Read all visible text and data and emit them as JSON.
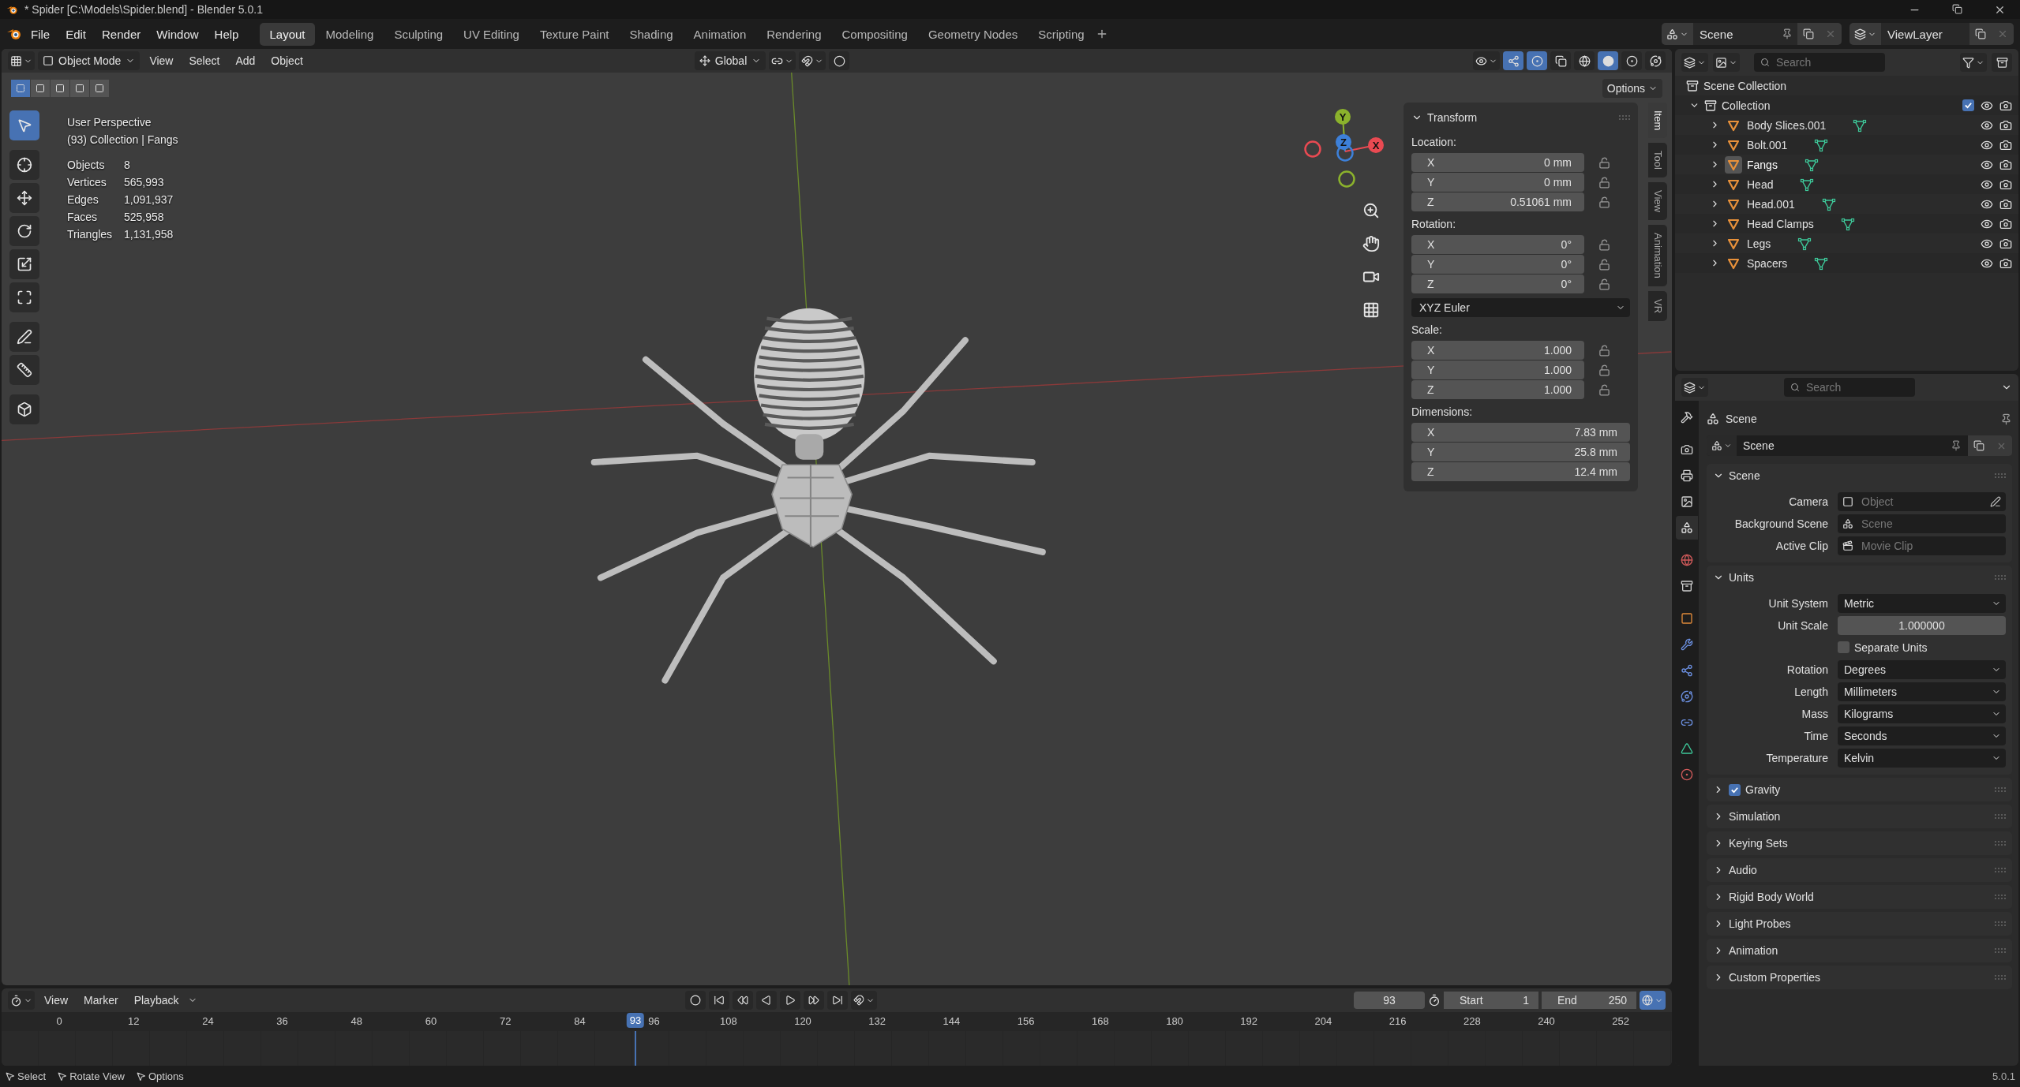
{
  "title_bar": {
    "title": "* Spider [C:\\Models\\Spider.blend] - Blender 5.0.1"
  },
  "top_bar": {
    "menus": [
      "File",
      "Edit",
      "Render",
      "Window",
      "Help"
    ],
    "workspaces": [
      {
        "label": "Layout",
        "selected": true
      },
      {
        "label": "Modeling",
        "selected": false
      },
      {
        "label": "Sculpting",
        "selected": false
      },
      {
        "label": "UV Editing",
        "selected": false
      },
      {
        "label": "Texture Paint",
        "selected": false
      },
      {
        "label": "Shading",
        "selected": false
      },
      {
        "label": "Animation",
        "selected": false
      },
      {
        "label": "Rendering",
        "selected": false
      },
      {
        "label": "Compositing",
        "selected": false
      },
      {
        "label": "Geometry Nodes",
        "selected": false
      },
      {
        "label": "Scripting",
        "selected": false
      }
    ],
    "scene": "Scene",
    "view_layer": "ViewLayer"
  },
  "viewport": {
    "mode": "Object Mode",
    "menus": [
      "View",
      "Select",
      "Add",
      "Object"
    ],
    "orientation": "Global",
    "options": "Options",
    "tools": [
      {
        "kind": "select",
        "selected": true
      },
      {
        "kind": "cursor",
        "selected": false
      },
      {
        "kind": "move",
        "selected": false
      },
      {
        "kind": "rotate",
        "selected": false
      },
      {
        "kind": "scale",
        "selected": false
      },
      {
        "kind": "transform",
        "selected": false
      },
      {
        "kind": "annotate",
        "selected": false
      },
      {
        "kind": "measure",
        "selected": false
      },
      {
        "kind": "add_cube",
        "selected": false
      }
    ],
    "info": {
      "perspective": "User Perspective",
      "context": "(93) Collection | Fangs",
      "stats": [
        {
          "label": "Objects",
          "value": "8"
        },
        {
          "label": "Vertices",
          "value": "565,993"
        },
        {
          "label": "Edges",
          "value": "1,091,937"
        },
        {
          "label": "Faces",
          "value": "525,958"
        },
        {
          "label": "Triangles",
          "value": "1,131,958"
        }
      ]
    },
    "gizmo": [
      {
        "label": "Y",
        "color": "#8bb22c"
      },
      {
        "label": "Z",
        "color": "#3d80d9"
      },
      {
        "label": "X",
        "color": "#e94a52"
      }
    ],
    "sidebar_tabs": [
      {
        "label": "Item",
        "selected": true
      },
      {
        "label": "Tool",
        "selected": false
      },
      {
        "label": "View",
        "selected": false
      },
      {
        "label": "Animation",
        "selected": false
      },
      {
        "label": "VR",
        "selected": false
      }
    ],
    "transform": {
      "title": "Transform",
      "expanded": true,
      "sections": [
        {
          "kind": "vector",
          "label": "Location:",
          "fields": [
            {
              "axis": "X",
              "value": "0 mm",
              "locked": false
            },
            {
              "axis": "Y",
              "value": "0 mm",
              "locked": false
            },
            {
              "axis": "Z",
              "value": "0.51061 mm",
              "locked": false
            }
          ]
        },
        {
          "kind": "vector",
          "label": "Rotation:",
          "fields": [
            {
              "axis": "X",
              "value": "0°",
              "locked": false
            },
            {
              "axis": "Y",
              "value": "0°",
              "locked": false
            },
            {
              "axis": "Z",
              "value": "0°",
              "locked": false
            }
          ]
        },
        {
          "kind": "dropdown",
          "value": "XYZ Euler"
        },
        {
          "kind": "vector",
          "label": "Scale:",
          "fields": [
            {
              "axis": "X",
              "value": "1.000",
              "locked": false
            },
            {
              "axis": "Y",
              "value": "1.000",
              "locked": false
            },
            {
              "axis": "Z",
              "value": "1.000",
              "locked": false
            }
          ]
        },
        {
          "kind": "dimensions",
          "label": "Dimensions:",
          "fields": [
            {
              "axis": "X",
              "value": "7.83 mm"
            },
            {
              "axis": "Y",
              "value": "25.8 mm"
            },
            {
              "axis": "Z",
              "value": "12.4 mm"
            }
          ]
        }
      ]
    }
  },
  "outliner": {
    "search": {
      "placeholder": "Search"
    },
    "root": "Scene Collection",
    "collection": {
      "label": "Collection",
      "expanded": true,
      "checked": true,
      "children": [
        {
          "label": "Body Slices.001",
          "selected": false
        },
        {
          "label": "Bolt.001",
          "selected": false
        },
        {
          "label": "Fangs",
          "selected": true
        },
        {
          "label": "Head",
          "selected": false
        },
        {
          "label": "Head.001",
          "selected": false
        },
        {
          "label": "Head Clamps",
          "selected": false
        },
        {
          "label": "Legs",
          "selected": false
        },
        {
          "label": "Spacers",
          "selected": false
        }
      ]
    }
  },
  "properties": {
    "search": {
      "placeholder": "Search"
    },
    "tabs": [
      {
        "kind": "tool",
        "selected": false
      },
      {
        "kind": "render",
        "selected": false
      },
      {
        "kind": "output",
        "selected": false
      },
      {
        "kind": "view_layer",
        "selected": false
      },
      {
        "kind": "scene",
        "selected": true
      },
      {
        "kind": "world",
        "selected": false
      },
      {
        "kind": "collection",
        "selected": false
      },
      {
        "kind": "object",
        "selected": false
      },
      {
        "kind": "modifiers",
        "selected": false
      },
      {
        "kind": "particles",
        "selected": false
      },
      {
        "kind": "physics",
        "selected": false
      },
      {
        "kind": "constraints",
        "selected": false
      },
      {
        "kind": "data",
        "selected": false
      },
      {
        "kind": "material",
        "selected": false
      }
    ],
    "context": "Scene",
    "datablock": "Scene",
    "panels": [
      {
        "title": "Scene",
        "expanded": true,
        "rows": [
          {
            "kind": "datablock",
            "label": "Camera",
            "placeholder": "Object"
          },
          {
            "kind": "datablock",
            "label": "Background Scene",
            "placeholder": "Scene"
          },
          {
            "kind": "datablock",
            "label": "Active Clip",
            "placeholder": "Movie Clip"
          }
        ]
      },
      {
        "title": "Units",
        "expanded": true,
        "rows": [
          {
            "kind": "dropdown",
            "label": "Unit System",
            "value": "Metric"
          },
          {
            "kind": "number",
            "label": "Unit Scale",
            "value": "1.000000"
          },
          {
            "kind": "checkbox",
            "label": "Separate Units",
            "checked": false
          },
          {
            "kind": "dropdown",
            "label": "Rotation",
            "value": "Degrees"
          },
          {
            "kind": "dropdown",
            "label": "Length",
            "value": "Millimeters"
          },
          {
            "kind": "dropdown",
            "label": "Mass",
            "value": "Kilograms"
          },
          {
            "kind": "dropdown",
            "label": "Time",
            "value": "Seconds"
          },
          {
            "kind": "dropdown",
            "label": "Temperature",
            "value": "Kelvin"
          }
        ]
      },
      {
        "title": "Gravity",
        "expanded": false,
        "checked": true
      },
      {
        "title": "Simulation",
        "expanded": false
      },
      {
        "title": "Keying Sets",
        "expanded": false
      },
      {
        "title": "Audio",
        "expanded": false
      },
      {
        "title": "Rigid Body World",
        "expanded": false
      },
      {
        "title": "Light Probes",
        "expanded": false
      },
      {
        "title": "Animation",
        "expanded": false
      },
      {
        "title": "Custom Properties",
        "expanded": false
      }
    ]
  },
  "timeline": {
    "menus": [
      "View",
      "Marker",
      "Playback"
    ],
    "frame": "93",
    "start": {
      "label": "Start",
      "value": "1"
    },
    "end": {
      "label": "End",
      "value": "250"
    },
    "ruler": [
      "0",
      "12",
      "24",
      "36",
      "48",
      "60",
      "72",
      "84",
      "96",
      "108",
      "120",
      "132",
      "144",
      "156",
      "168",
      "180",
      "192",
      "204",
      "216",
      "228",
      "240",
      "252"
    ],
    "playhead": "93"
  },
  "status_bar": {
    "hints": [
      "Select",
      "Rotate View",
      "Options"
    ],
    "version": "5.0.1"
  }
}
